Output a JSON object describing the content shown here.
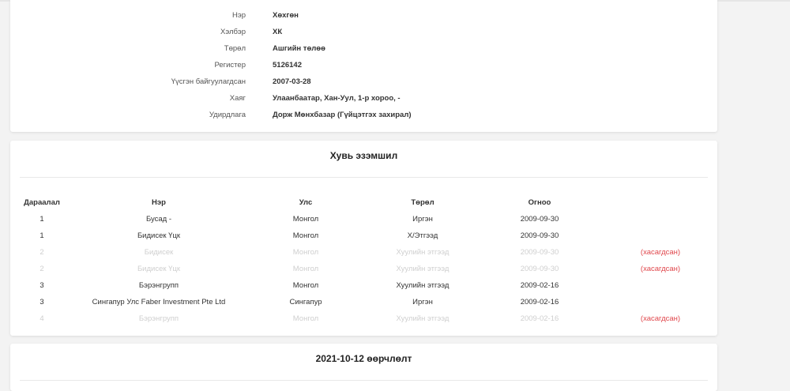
{
  "company": {
    "rows": [
      {
        "label": "Нэр",
        "value": "Хөхгөн"
      },
      {
        "label": "Хэлбэр",
        "value": "ХК"
      },
      {
        "label": "Төрөл",
        "value": "Ашгийн төлөө"
      },
      {
        "label": "Регистер",
        "value": "5126142"
      },
      {
        "label": "Үүсгэн байгуулагдсан",
        "value": "2007-03-28"
      },
      {
        "label": "Хаяг",
        "value": "Улаанбаатар, Хан-Уул, 1-р хороо, -"
      },
      {
        "label": "Удирдлага",
        "value": "Дорж Мөнхбазар (Гүйцэтгэх захирал)"
      }
    ]
  },
  "owners": {
    "title": "Хувь эзэмшил",
    "headers": [
      "Дараалал",
      "Нэр",
      "Улс",
      "Төрөл",
      "Огноо"
    ],
    "rows": [
      {
        "order": "1",
        "name": "Бусад -",
        "country": "Монгол",
        "type": "Иргэн",
        "date": "2009-09-30",
        "status": ""
      },
      {
        "order": "1",
        "name": "Бидисек Үцк",
        "country": "Монгол",
        "type": "Х/Этгээд",
        "date": "2009-09-30",
        "status": ""
      },
      {
        "order": "2",
        "name": "Бидисек",
        "country": "Монгол",
        "type": "Хуулийн этгээд",
        "date": "2009-09-30",
        "status": "(хасагдсан)"
      },
      {
        "order": "2",
        "name": "Бидисек Үцк",
        "country": "Монгол",
        "type": "Хуулийн этгээд",
        "date": "2009-09-30",
        "status": "(хасагдсан)"
      },
      {
        "order": "3",
        "name": "Бэрэнгрупп",
        "country": "Монгол",
        "type": "Хуулийн этгээд",
        "date": "2009-02-16",
        "status": ""
      },
      {
        "order": "3",
        "name": "Сингапур Улс Faber Investment Pte Ltd",
        "country": "Сингапур",
        "type": "Иргэн",
        "date": "2009-02-16",
        "status": ""
      },
      {
        "order": "4",
        "name": "Бэрэнгрупп",
        "country": "Монгол",
        "type": "Хуулийн этгээд",
        "date": "2009-02-16",
        "status": "(хасагдсан)"
      }
    ]
  },
  "change": {
    "title": "2021-10-12 өөрчлөлт"
  }
}
